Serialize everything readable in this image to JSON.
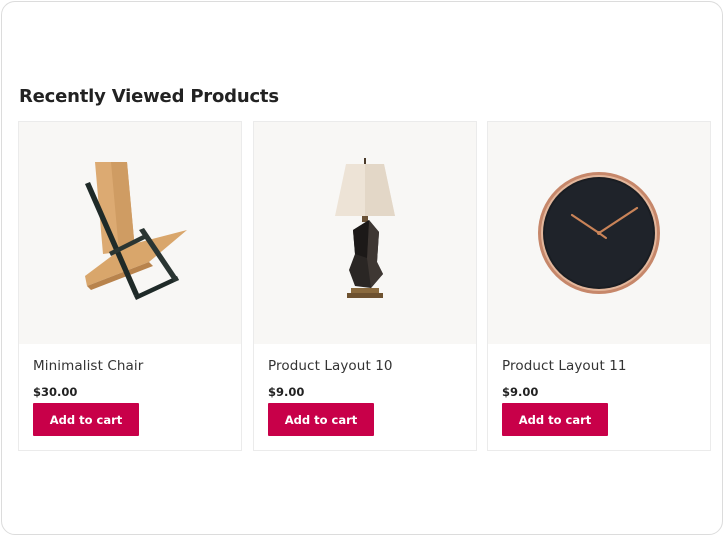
{
  "section": {
    "title": "Recently Viewed Products"
  },
  "products": [
    {
      "name": "Minimalist Chair",
      "price": "$30.00",
      "button": "Add to cart",
      "image_icon": "chair-image"
    },
    {
      "name": "Product Layout 10",
      "price": "$9.00",
      "button": "Add to cart",
      "image_icon": "table-lamp-image"
    },
    {
      "name": "Product Layout 11",
      "price": "$9.00",
      "button": "Add to cart",
      "image_icon": "wall-clock-image"
    }
  ],
  "colors": {
    "accent": "#c80049",
    "media_bg": "#f8f7f5",
    "title": "#222222"
  }
}
